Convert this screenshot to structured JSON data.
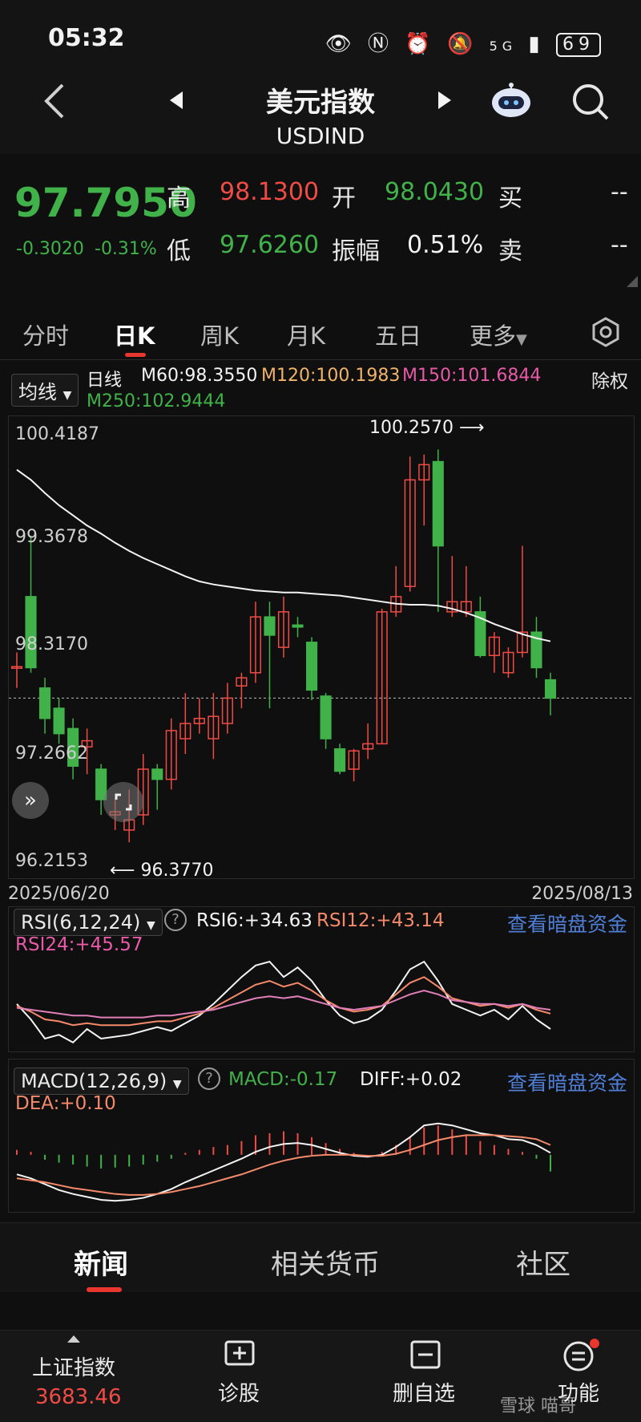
{
  "status_bar": {
    "time": "05:32",
    "battery": "69",
    "network": "5G"
  },
  "header": {
    "title": "美元指数",
    "code": "USDIND"
  },
  "quote": {
    "price": "97.7950",
    "change": "-0.3020",
    "change_pct": "-0.31%",
    "high_label": "高",
    "high": "98.1300",
    "open_label": "开",
    "open": "98.0430",
    "buy_label": "买",
    "buy": "--",
    "low_label": "低",
    "low": "97.6260",
    "amp_label": "振幅",
    "amp": "0.51%",
    "sell_label": "卖",
    "sell": "--"
  },
  "tabs": [
    "分时",
    "日K",
    "周K",
    "月K",
    "五日",
    "更多"
  ],
  "ma": {
    "selector": "均线",
    "period": "日线",
    "m60": "M60:98.3550",
    "m120": "M120:100.1983",
    "m150": "M150:101.6844",
    "m250": "M250:102.9444",
    "right": "除权"
  },
  "price_axis": {
    "labels": [
      "100.4187",
      "99.3678",
      "98.3170",
      "97.2662",
      "96.2153"
    ],
    "max_label": "100.2570",
    "min_label": "96.3770"
  },
  "dates": {
    "start": "2025/06/20",
    "end": "2025/08/13"
  },
  "rsi": {
    "selector": "RSI(6,12,24)",
    "rsi6": "RSI6:+34.63",
    "rsi12": "RSI12:+43.14",
    "rsi24": "RSI24:+45.57",
    "link": "查看暗盘资金"
  },
  "macd": {
    "selector": "MACD(12,26,9)",
    "macd": "MACD:-0.17",
    "diff": "DIFF:+0.02",
    "dea": "DEA:+0.10",
    "link": "查看暗盘资金"
  },
  "news_tabs": [
    "新闻",
    "相关货币",
    "社区"
  ],
  "bottom_bar": {
    "index_name": "上证指数",
    "index_value": "3683.46",
    "diagnose": "诊股",
    "remove_watch": "删自选",
    "functions": "功能",
    "watermark": "雪球 喵哥"
  },
  "colors": {
    "up": "#f04b45",
    "down": "#41b24a",
    "accent": "#e9362f",
    "link": "#4f7fd6",
    "m60": "#f3f3f3",
    "m120": "#f0b36a",
    "m150": "#e65aa8",
    "m250": "#41b24a"
  },
  "chart_data": [
    {
      "type": "candlestick",
      "title": "",
      "ylim": [
        96.2153,
        100.4187
      ],
      "y_ticks": [
        100.4187,
        99.3678,
        98.317,
        97.2662,
        96.2153
      ],
      "x_range": [
        "2025/06/20",
        "2025/08/13"
      ],
      "candles": [
        {
          "o": 98.1,
          "c": 98.11,
          "h": 98.25,
          "l": 97.9
        },
        {
          "o": 98.8,
          "c": 98.1,
          "h": 99.4,
          "l": 98.05
        },
        {
          "o": 97.9,
          "c": 97.6,
          "h": 98.0,
          "l": 97.45
        },
        {
          "o": 97.7,
          "c": 97.45,
          "h": 97.8,
          "l": 97.35
        },
        {
          "o": 97.5,
          "c": 97.13,
          "h": 97.6,
          "l": 97.0
        },
        {
          "o": 97.32,
          "c": 97.38,
          "h": 97.5,
          "l": 97.05
        },
        {
          "o": 97.1,
          "c": 96.8,
          "h": 97.15,
          "l": 96.65
        },
        {
          "o": 96.65,
          "c": 96.68,
          "h": 96.8,
          "l": 96.5
        },
        {
          "o": 96.5,
          "c": 96.6,
          "h": 96.9,
          "l": 96.38
        },
        {
          "o": 96.65,
          "c": 97.1,
          "h": 97.25,
          "l": 96.55
        },
        {
          "o": 97.1,
          "c": 97.0,
          "h": 97.15,
          "l": 96.7
        },
        {
          "o": 97.0,
          "c": 97.48,
          "h": 97.6,
          "l": 96.9
        },
        {
          "o": 97.4,
          "c": 97.55,
          "h": 97.85,
          "l": 97.25
        },
        {
          "o": 97.55,
          "c": 97.6,
          "h": 97.8,
          "l": 97.45
        },
        {
          "o": 97.4,
          "c": 97.62,
          "h": 97.85,
          "l": 97.2
        },
        {
          "o": 97.55,
          "c": 97.8,
          "h": 97.95,
          "l": 97.45
        },
        {
          "o": 97.92,
          "c": 98.0,
          "h": 98.05,
          "l": 97.7
        },
        {
          "o": 98.05,
          "c": 98.6,
          "h": 98.75,
          "l": 97.95
        },
        {
          "o": 98.6,
          "c": 98.42,
          "h": 98.75,
          "l": 97.7
        },
        {
          "o": 98.3,
          "c": 98.65,
          "h": 98.8,
          "l": 98.2
        },
        {
          "o": 98.52,
          "c": 98.5,
          "h": 98.6,
          "l": 98.4
        },
        {
          "o": 98.35,
          "c": 97.88,
          "h": 98.4,
          "l": 97.78
        },
        {
          "o": 97.82,
          "c": 97.4,
          "h": 97.85,
          "l": 97.3
        },
        {
          "o": 97.3,
          "c": 97.08,
          "h": 97.35,
          "l": 97.05
        },
        {
          "o": 97.1,
          "c": 97.28,
          "h": 97.3,
          "l": 96.98
        },
        {
          "o": 97.3,
          "c": 97.35,
          "h": 97.55,
          "l": 97.2
        },
        {
          "o": 97.35,
          "c": 98.65,
          "h": 98.68,
          "l": 97.35
        },
        {
          "o": 98.65,
          "c": 98.8,
          "h": 99.1,
          "l": 98.6
        },
        {
          "o": 98.9,
          "c": 99.95,
          "h": 100.18,
          "l": 98.85
        },
        {
          "o": 99.95,
          "c": 100.1,
          "h": 100.2,
          "l": 99.5
        },
        {
          "o": 100.13,
          "c": 99.3,
          "h": 100.25,
          "l": 98.65
        },
        {
          "o": 98.65,
          "c": 98.75,
          "h": 99.2,
          "l": 98.6
        },
        {
          "o": 98.65,
          "c": 98.75,
          "h": 99.1,
          "l": 98.6
        },
        {
          "o": 98.65,
          "c": 98.22,
          "h": 98.8,
          "l": 98.2
        },
        {
          "o": 98.22,
          "c": 98.4,
          "h": 98.45,
          "l": 98.05
        },
        {
          "o": 98.05,
          "c": 98.25,
          "h": 98.3,
          "l": 98.0
        },
        {
          "o": 98.25,
          "c": 98.45,
          "h": 99.3,
          "l": 98.2
        },
        {
          "o": 98.45,
          "c": 98.1,
          "h": 98.6,
          "l": 98.0
        },
        {
          "o": 97.98,
          "c": 97.8,
          "h": 98.05,
          "l": 97.63
        }
      ],
      "ma60": [
        100.05,
        99.95,
        99.82,
        99.7,
        99.6,
        99.5,
        99.42,
        99.33,
        99.25,
        99.18,
        99.12,
        99.06,
        99.0,
        98.95,
        98.92,
        98.9,
        98.88,
        98.86,
        98.85,
        98.84,
        98.84,
        98.83,
        98.82,
        98.81,
        98.79,
        98.77,
        98.75,
        98.73,
        98.72,
        98.72,
        98.71,
        98.68,
        98.64,
        98.59,
        98.53,
        98.48,
        98.43,
        98.39,
        98.36
      ]
    },
    {
      "type": "line",
      "title": "RSI(6,12,24)",
      "ylim": [
        0,
        100
      ],
      "series": [
        {
          "name": "RSI6",
          "values": [
            48,
            40,
            30,
            32,
            28,
            35,
            30,
            31,
            32,
            34,
            36,
            34,
            38,
            42,
            48,
            55,
            62,
            68,
            70,
            62,
            67,
            60,
            50,
            42,
            38,
            40,
            45,
            55,
            66,
            70,
            60,
            48,
            45,
            42,
            45,
            40,
            47,
            40,
            35
          ]
        },
        {
          "name": "RSI12",
          "values": [
            47,
            44,
            40,
            39,
            37,
            38,
            37,
            37,
            37,
            38,
            39,
            39,
            41,
            43,
            46,
            50,
            54,
            58,
            60,
            57,
            59,
            55,
            50,
            46,
            44,
            45,
            47,
            53,
            59,
            62,
            57,
            51,
            49,
            47,
            48,
            46,
            48,
            45,
            43
          ]
        },
        {
          "name": "RSI24",
          "values": [
            46,
            45,
            44,
            43,
            42,
            42,
            41,
            41,
            41,
            41,
            42,
            42,
            43,
            44,
            45,
            47,
            49,
            51,
            52,
            51,
            52,
            50,
            48,
            46,
            45,
            46,
            47,
            50,
            53,
            55,
            53,
            50,
            49,
            48,
            48,
            47,
            48,
            46,
            45
          ]
        }
      ]
    },
    {
      "type": "bar+line",
      "title": "MACD(12,26,9)",
      "ylim": [
        -0.6,
        0.6
      ],
      "series": [
        {
          "name": "MACD",
          "values": [
            0.05,
            0.03,
            -0.05,
            -0.08,
            -0.1,
            -0.12,
            -0.14,
            -0.13,
            -0.12,
            -0.1,
            -0.07,
            -0.04,
            0.02,
            0.05,
            0.08,
            0.1,
            0.14,
            0.2,
            0.22,
            0.24,
            0.22,
            0.18,
            0.12,
            0.06,
            0.02,
            0.0,
            0.03,
            0.1,
            0.18,
            0.28,
            0.3,
            0.26,
            0.2,
            0.14,
            0.1,
            0.06,
            0.03,
            -0.04,
            -0.17
          ]
        },
        {
          "name": "DIFF",
          "values": [
            -0.2,
            -0.24,
            -0.3,
            -0.36,
            -0.4,
            -0.43,
            -0.46,
            -0.47,
            -0.46,
            -0.44,
            -0.4,
            -0.35,
            -0.28,
            -0.22,
            -0.16,
            -0.1,
            -0.04,
            0.03,
            0.08,
            0.11,
            0.12,
            0.1,
            0.06,
            0.02,
            -0.01,
            -0.02,
            0.0,
            0.08,
            0.18,
            0.3,
            0.32,
            0.3,
            0.26,
            0.22,
            0.2,
            0.16,
            0.15,
            0.1,
            0.02
          ]
        },
        {
          "name": "DEA",
          "values": [
            -0.24,
            -0.26,
            -0.28,
            -0.31,
            -0.34,
            -0.36,
            -0.38,
            -0.4,
            -0.41,
            -0.41,
            -0.4,
            -0.38,
            -0.35,
            -0.32,
            -0.28,
            -0.24,
            -0.2,
            -0.15,
            -0.1,
            -0.06,
            -0.03,
            -0.01,
            0.0,
            0.0,
            0.0,
            -0.01,
            -0.01,
            0.01,
            0.05,
            0.1,
            0.15,
            0.18,
            0.2,
            0.2,
            0.2,
            0.19,
            0.18,
            0.16,
            0.1
          ]
        }
      ]
    }
  ]
}
